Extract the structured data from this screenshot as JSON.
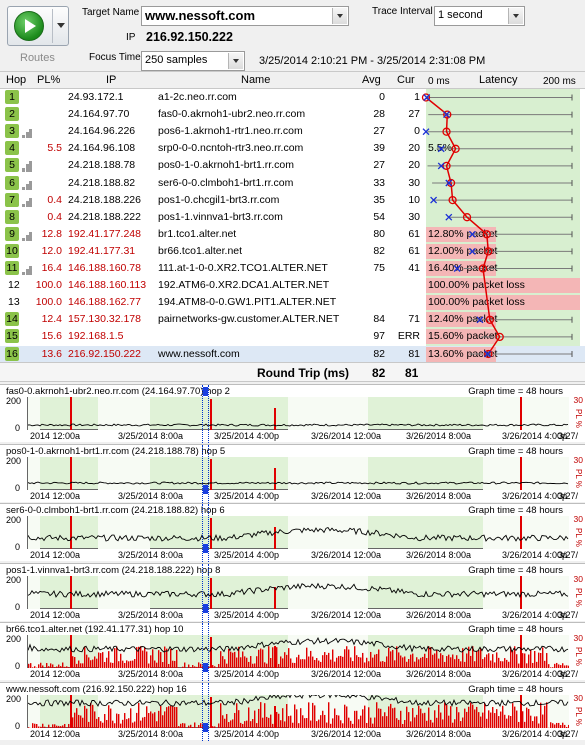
{
  "toolbar": {
    "routes_label": "Routes",
    "target_name_label": "Target Name",
    "target_name": "www.nessoft.com",
    "ip_label": "IP",
    "ip": "216.92.150.222",
    "focus_time_label": "Focus Time",
    "focus_time": "250 samples",
    "time_range": "3/25/2014 2:10:21 PM - 3/25/2014 2:31:08 PM",
    "trace_interval_label": "Trace Interval",
    "trace_interval": "1 second"
  },
  "columns": {
    "hop": "Hop",
    "pl": "PL%",
    "ip": "IP",
    "name": "Name",
    "avg": "Avg",
    "cur": "Cur",
    "lat_min": "0 ms",
    "latency": "Latency",
    "lat_max": "200 ms"
  },
  "hops": [
    {
      "hop": "1",
      "pl": "",
      "ip": "24.93.172.1",
      "name": "a1-2c.neo.rr.com",
      "avg": "0",
      "cur": "1",
      "avg_ms": 0,
      "label": ""
    },
    {
      "hop": "2",
      "pl": "",
      "ip": "24.164.97.70",
      "name": "fas0-0.akrnoh1-ubr2.neo.rr.com",
      "avg": "28",
      "cur": "27",
      "avg_ms": 28,
      "label": ""
    },
    {
      "hop": "3",
      "pl": "",
      "ip": "24.164.96.226",
      "name": "pos6-1.akrnoh1-rtr1.neo.rr.com",
      "avg": "27",
      "cur": "0",
      "avg_ms": 27,
      "label": ""
    },
    {
      "hop": "4",
      "pl": "5.5",
      "ip": "24.164.96.108",
      "name": "srp0-0-0.ncntoh-rtr3.neo.rr.com",
      "avg": "39",
      "cur": "20",
      "avg_ms": 39,
      "label": "5.5%"
    },
    {
      "hop": "5",
      "pl": "",
      "ip": "24.218.188.78",
      "name": "pos0-1-0.akrnoh1-brt1.rr.com",
      "avg": "27",
      "cur": "20",
      "avg_ms": 27,
      "label": ""
    },
    {
      "hop": "6",
      "pl": "",
      "ip": "24.218.188.82",
      "name": "ser6-0-0.clmboh1-brt1.rr.com",
      "avg": "33",
      "cur": "30",
      "avg_ms": 33,
      "label": ""
    },
    {
      "hop": "7",
      "pl": "0.4",
      "ip": "24.218.188.226",
      "name": "pos1-0.chcgil1-brt3.rr.com",
      "avg": "35",
      "cur": "10",
      "avg_ms": 35,
      "label": ""
    },
    {
      "hop": "8",
      "pl": "0.4",
      "ip": "24.218.188.222",
      "name": "pos1-1.vinnva1-brt3.rr.com",
      "avg": "54",
      "cur": "30",
      "avg_ms": 54,
      "label": ""
    },
    {
      "hop": "9",
      "pl": "12.8",
      "ip": "192.41.177.248",
      "name": "br1.tco1.alter.net",
      "avg": "80",
      "cur": "61",
      "avg_ms": 80,
      "label": "12.80% packet loss"
    },
    {
      "hop": "10",
      "pl": "12.0",
      "ip": "192.41.177.31",
      "name": "br66.tco1.alter.net",
      "avg": "82",
      "cur": "61",
      "avg_ms": 82,
      "label": "12.00% packet loss"
    },
    {
      "hop": "11",
      "pl": "16.4",
      "ip": "146.188.160.78",
      "name": "111.at-1-0-0.XR2.TCO1.ALTER.NET",
      "avg": "75",
      "cur": "41",
      "avg_ms": 75,
      "label": "16.40% packet loss"
    },
    {
      "hop": "12",
      "pl": "100.0",
      "ip": "146.188.160.113",
      "name": "192.ATM6-0.XR2.DCA1.ALTER.NET",
      "avg": "",
      "cur": "",
      "avg_ms": null,
      "label": "100.00% packet loss"
    },
    {
      "hop": "13",
      "pl": "100.0",
      "ip": "146.188.162.77",
      "name": "194.ATM8-0-0.GW1.PIT1.ALTER.NET",
      "avg": "",
      "cur": "",
      "avg_ms": null,
      "label": "100.00% packet loss"
    },
    {
      "hop": "14",
      "pl": "12.4",
      "ip": "157.130.32.178",
      "name": "pairnetworks-gw.customer.ALTER.NET",
      "avg": "84",
      "cur": "71",
      "avg_ms": 84,
      "label": "12.40% packet loss"
    },
    {
      "hop": "15",
      "pl": "15.6",
      "ip": "192.168.1.5",
      "name": "",
      "avg": "97",
      "cur": "ERR",
      "avg_ms": 97,
      "label": "15.60% packet loss"
    },
    {
      "hop": "16",
      "pl": "13.6",
      "ip": "216.92.150.222",
      "name": "www.nessoft.com",
      "avg": "82",
      "cur": "81",
      "avg_ms": 82,
      "label": "13.60% packet loss"
    }
  ],
  "round_trip": {
    "label": "Round Trip (ms)",
    "avg": "82",
    "cur": "81"
  },
  "graphs": [
    {
      "title": "fas0-0.akrnoh1-ubr2.neo.rr.com (24.164.97.70) hop 2",
      "time": "Graph time = 48 hours"
    },
    {
      "title": "pos0-1-0.akrnoh1-brt1.rr.com (24.218.188.78) hop 5",
      "time": "Graph time = 48 hours"
    },
    {
      "title": "ser6-0-0.clmboh1-brt1.rr.com (24.218.188.82) hop 6",
      "time": "Graph time = 48 hours"
    },
    {
      "title": "pos1-1.vinnva1-brt3.rr.com (24.218.188.222) hop 8",
      "time": "Graph time = 48 hours"
    },
    {
      "title": "br66.tco1.alter.net (192.41.177.31) hop 10",
      "time": "Graph time = 48 hours"
    },
    {
      "title": "www.nessoft.com (216.92.150.222) hop 16",
      "time": "Graph time = 48 hours"
    }
  ],
  "graph_axis": {
    "y_max": "200",
    "y_min": "0",
    "pl_max": "30",
    "pl_label": "PL %",
    "x_ticks": [
      "2014 12:00a",
      "3/25/2014 8:00a",
      "3/25/2014 4:00p",
      "3/26/2014 12:00a",
      "3/26/2014 8:00a",
      "3/26/2014 4:00p",
      "3/27/"
    ]
  },
  "colors": {
    "hop_ok": "#8bc34a",
    "pl_red": "#c00000",
    "latency_bg": "#d8efd0",
    "loss_bar": "#f4b6b6",
    "graph_bg": "#e0f2d7",
    "graph_loss": "#e00000"
  }
}
